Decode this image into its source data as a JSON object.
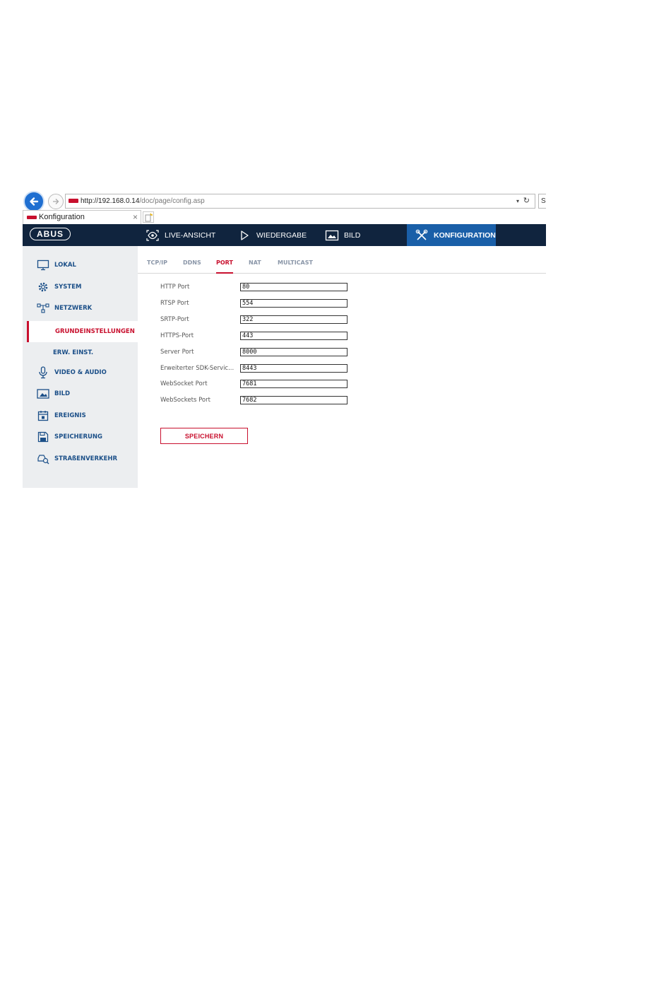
{
  "browser": {
    "url_host": "http://192.168.0.14",
    "url_path": "/doc/page/config.asp",
    "search_stub": "S",
    "tab_title": "Konfiguration",
    "tab_close": "×",
    "url_dropdown": "▾",
    "url_refresh": "↻"
  },
  "header": {
    "logo": "ABUS",
    "nav": [
      {
        "label": "LIVE-ANSICHT",
        "icon": "eye-icon"
      },
      {
        "label": "WIEDERGABE",
        "icon": "play-icon"
      },
      {
        "label": "BILD",
        "icon": "image-icon"
      },
      {
        "label": "KONFIGURATION",
        "icon": "tools-icon",
        "active": true
      }
    ]
  },
  "sidebar": {
    "items": [
      {
        "label": "LOKAL",
        "icon": "monitor-icon"
      },
      {
        "label": "SYSTEM",
        "icon": "gear-icon"
      },
      {
        "label": "NETZWERK",
        "icon": "network-icon"
      },
      {
        "label": "GRUNDEINSTELLUNGEN",
        "sub": true,
        "active": true
      },
      {
        "label": "ERW. EINST.",
        "sub": true
      },
      {
        "label": "VIDEO & AUDIO",
        "icon": "microphone-icon"
      },
      {
        "label": "BILD",
        "icon": "image-icon"
      },
      {
        "label": "EREIGNIS",
        "icon": "calendar-icon"
      },
      {
        "label": "SPEICHERUNG",
        "icon": "save-icon"
      },
      {
        "label": "STRAßENVERKEHR",
        "icon": "car-search-icon"
      }
    ]
  },
  "tabs": [
    {
      "label": "TCP/IP"
    },
    {
      "label": "DDNS"
    },
    {
      "label": "PORT",
      "active": true
    },
    {
      "label": "NAT"
    },
    {
      "label": "MULTICAST"
    }
  ],
  "form": {
    "rows": [
      {
        "label": "HTTP Port",
        "value": "80"
      },
      {
        "label": "RTSP Port",
        "value": "554"
      },
      {
        "label": "SRTP-Port",
        "value": "322"
      },
      {
        "label": "HTTPS-Port",
        "value": "443"
      },
      {
        "label": "Server Port",
        "value": "8000"
      },
      {
        "label": "Erweiterter SDK-Servic...",
        "value": "8443"
      },
      {
        "label": "WebSocket Port",
        "value": "7681"
      },
      {
        "label": "WebSockets Port",
        "value": "7682"
      }
    ],
    "save_label": "SPEICHERN"
  },
  "colors": {
    "header_bg": "#10243e",
    "nav_active_bg": "#1a5fa8",
    "accent_red": "#c8102e",
    "sidebar_bg": "#eceef0",
    "link_blue": "#1b4f88"
  }
}
